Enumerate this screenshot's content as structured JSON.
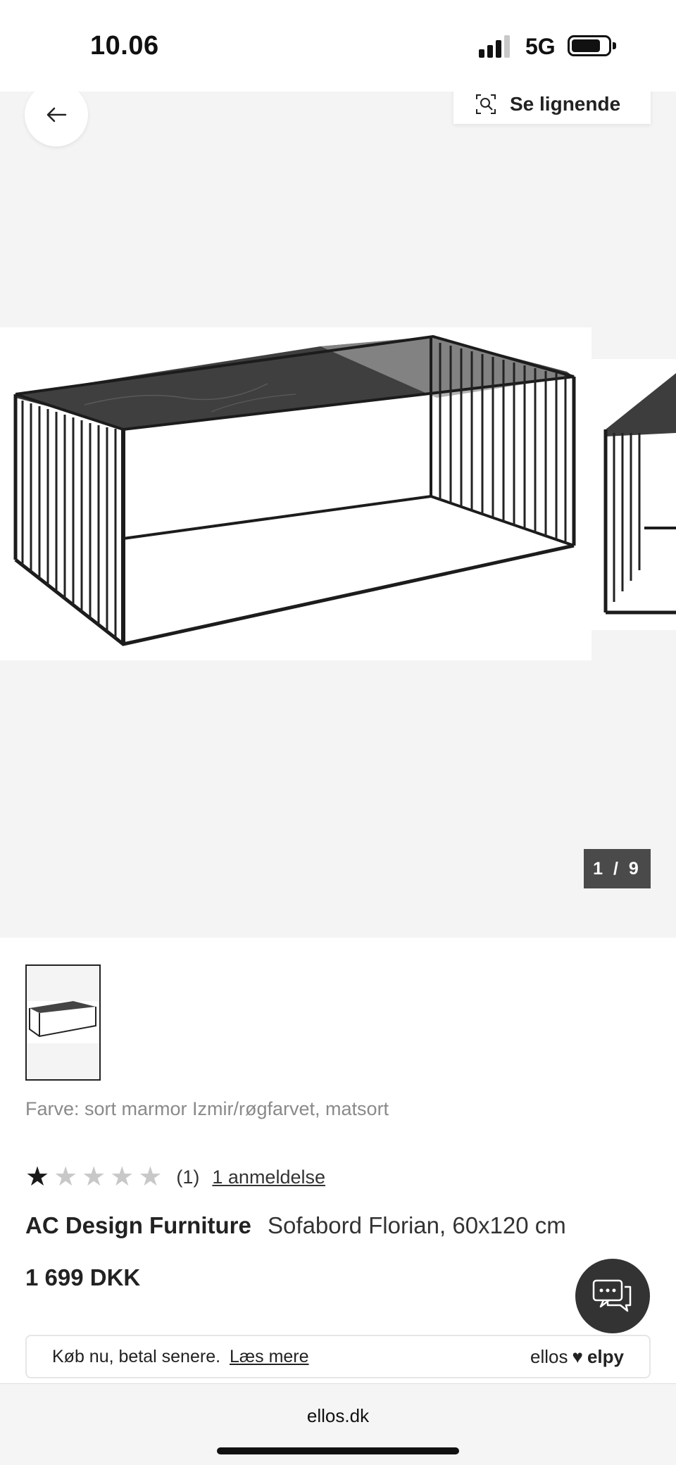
{
  "status_bar": {
    "time": "10.06",
    "network": "5G"
  },
  "gallery": {
    "similar_label": "Se lignende",
    "counter": "1 / 9"
  },
  "product": {
    "color_line": "Farve: sort marmor Izmir/røgfarvet, matsort",
    "rating": 1,
    "rating_max": 5,
    "review_count": "(1)",
    "review_link": "1 anmeldelse",
    "brand": "AC Design Furniture",
    "name": "Sofabord Florian, 60x120 cm",
    "price": "1 699 DKK"
  },
  "bnpl": {
    "text": "Køb nu, betal senere.",
    "link": "Læs mere",
    "logo_left": "ellos",
    "logo_right": "elpy"
  },
  "browser": {
    "url": "ellos.dk"
  }
}
